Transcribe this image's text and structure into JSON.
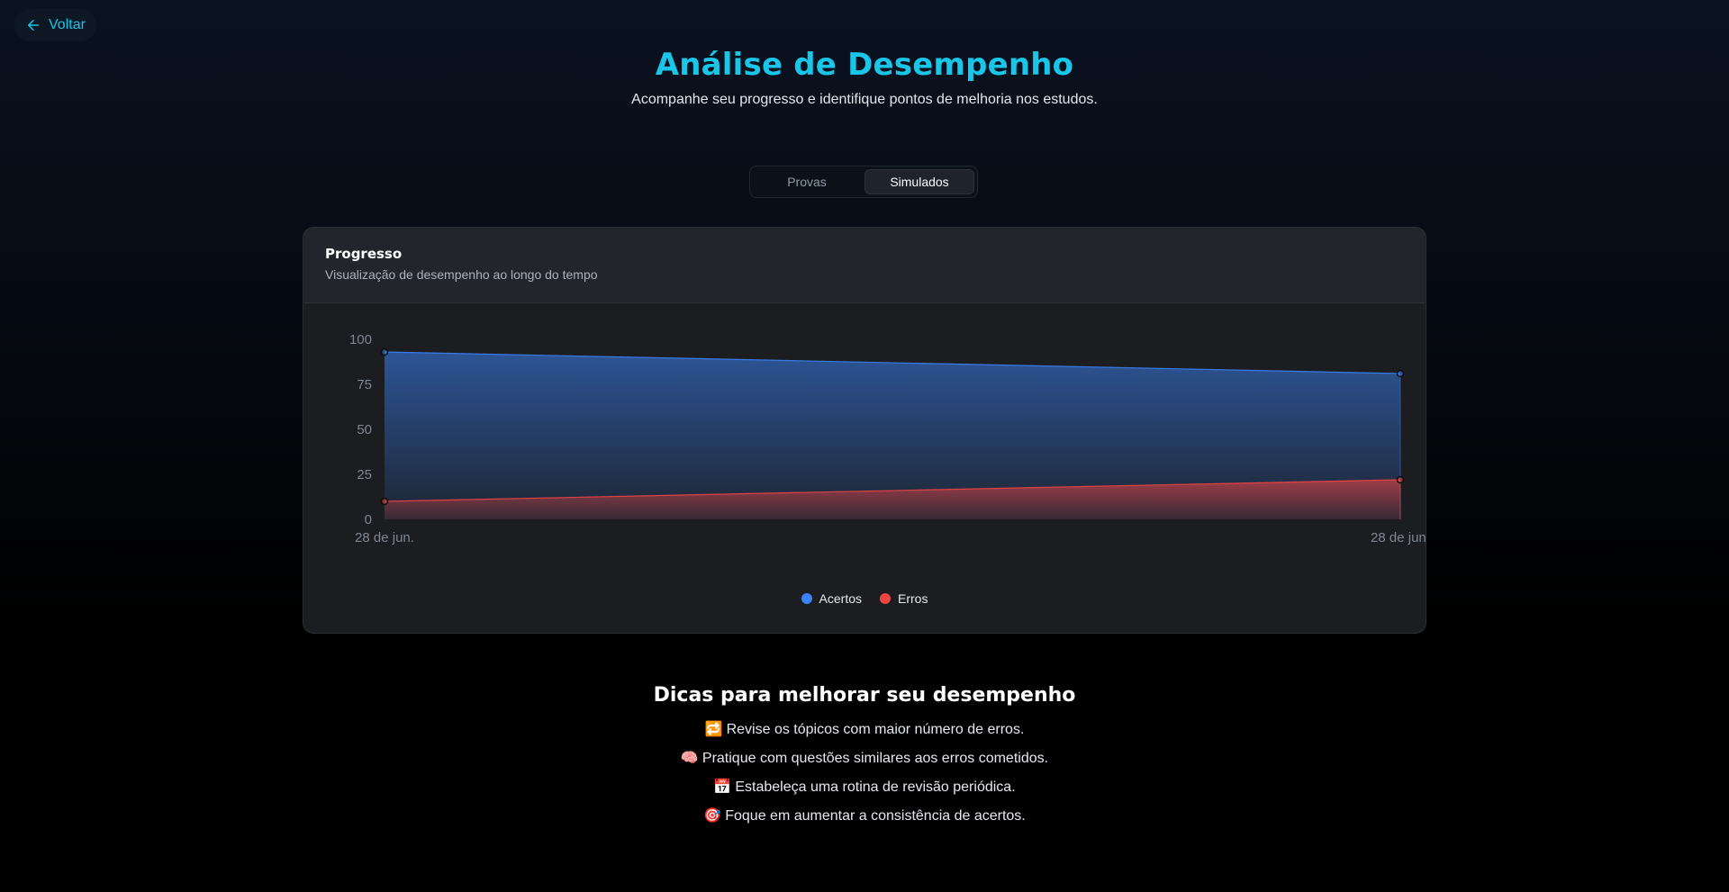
{
  "nav": {
    "back_label": "Voltar"
  },
  "header": {
    "title": "Análise de Desempenho",
    "subtitle": "Acompanhe seu progresso e identifique pontos de melhoria nos estudos."
  },
  "tabs": [
    {
      "label": "Provas",
      "active": false
    },
    {
      "label": "Simulados",
      "active": true
    }
  ],
  "card": {
    "title": "Progresso",
    "subtitle": "Visualização de desempenho ao longo do tempo"
  },
  "colors": {
    "accent": "#19c6e8",
    "acertos": "#3b82f6",
    "erros": "#ef4444"
  },
  "chart_data": {
    "type": "area",
    "categories": [
      "28 de jun.",
      "28 de jun."
    ],
    "series": [
      {
        "name": "Acertos",
        "values": [
          93,
          81
        ],
        "color": "#3b82f6"
      },
      {
        "name": "Erros",
        "values": [
          10,
          22
        ],
        "color": "#ef4444"
      }
    ],
    "yticks": [
      0,
      25,
      50,
      75,
      100
    ],
    "ylim": [
      0,
      100
    ],
    "grid": false,
    "legend": "bottom-center"
  },
  "tips": {
    "title": "Dicas para melhorar seu desempenho",
    "items": [
      {
        "icon": "repeat-icon",
        "glyph": "🔁",
        "text": "Revise os tópicos com maior número de erros."
      },
      {
        "icon": "brain-icon",
        "glyph": "🧠",
        "text": "Pratique com questões similares aos erros cometidos."
      },
      {
        "icon": "calendar-icon",
        "glyph": "📅",
        "text": "Estabeleça uma rotina de revisão periódica."
      },
      {
        "icon": "target-icon",
        "glyph": "🎯",
        "text": "Foque em aumentar a consistência de acertos."
      }
    ]
  }
}
